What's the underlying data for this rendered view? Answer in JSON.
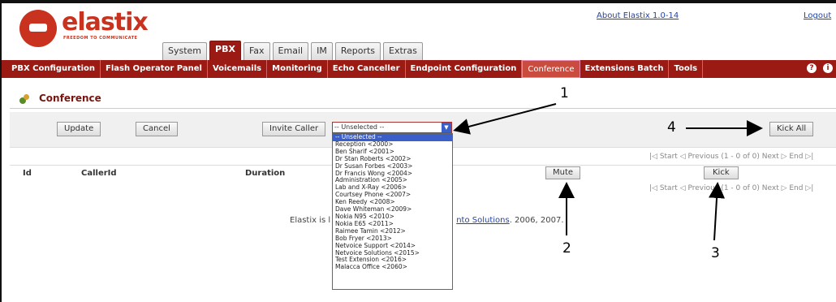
{
  "header": {
    "logo_text": "elastix",
    "logo_tagline": "FREEDOM TO COMMUNICATE",
    "about_link": "About Elastix 1.0-14",
    "logout_link": "Logout"
  },
  "main_tabs": [
    {
      "label": "System"
    },
    {
      "label": "PBX",
      "active": true
    },
    {
      "label": "Fax"
    },
    {
      "label": "Email"
    },
    {
      "label": "IM"
    },
    {
      "label": "Reports"
    },
    {
      "label": "Extras"
    }
  ],
  "submenu": [
    {
      "label": "PBX Configuration"
    },
    {
      "label": "Flash Operator Panel"
    },
    {
      "label": "Voicemails"
    },
    {
      "label": "Monitoring"
    },
    {
      "label": "Echo Canceller"
    },
    {
      "label": "Endpoint Configuration"
    },
    {
      "label": "Conference",
      "active": true
    },
    {
      "label": "Extensions Batch"
    },
    {
      "label": "Tools"
    }
  ],
  "page": {
    "title": "Conference"
  },
  "toolbar": {
    "update_label": "Update",
    "cancel_label": "Cancel",
    "invite_label": "Invite Caller",
    "select_value": "-- Unselected --",
    "kick_all_label": "Kick All"
  },
  "dropdown_options": [
    "-- Unselected --",
    "Reception <2000>",
    "Ben Sharif <2001>",
    "Dr Stan Roberts <2002>",
    "Dr Susan Forbes <2003>",
    "Dr Francis Wong <2004>",
    "Administration <2005>",
    "Lab and X-Ray <2006>",
    "Courtsey Phone <2007>",
    "Ken Reedy <2008>",
    "Dave Whiteman <2009>",
    "Nokia N95 <2010>",
    "Nokia E65 <2011>",
    "Raimee Tamin <2012>",
    "Bob Fryer <2013>",
    "Netvoice Support <2014>",
    "Netvoice Solutions <2015>",
    "Test Extension <2016>",
    "Malacca Office <2060>"
  ],
  "navigation": {
    "top": "|◁ Start ◁ Previous (1 - 0 of 0) Next ▷ End ▷|",
    "bottom": "|◁ Start ◁ Previous (1 - 0 of 0) Next ▷ End ▷|"
  },
  "table": {
    "columns": [
      "Id",
      "CallerId",
      "Duration"
    ],
    "mute_label": "Mute",
    "kick_label": "Kick"
  },
  "footer": {
    "prefix": "Elastix is l",
    "link": "nto Solutions",
    "suffix": ". 2006, 2007."
  },
  "annotations": [
    "1",
    "2",
    "3",
    "4"
  ],
  "colors": {
    "brand_red": "#9b1b14",
    "logo_red": "#c8321e",
    "select_blue": "#3a5fc8"
  }
}
